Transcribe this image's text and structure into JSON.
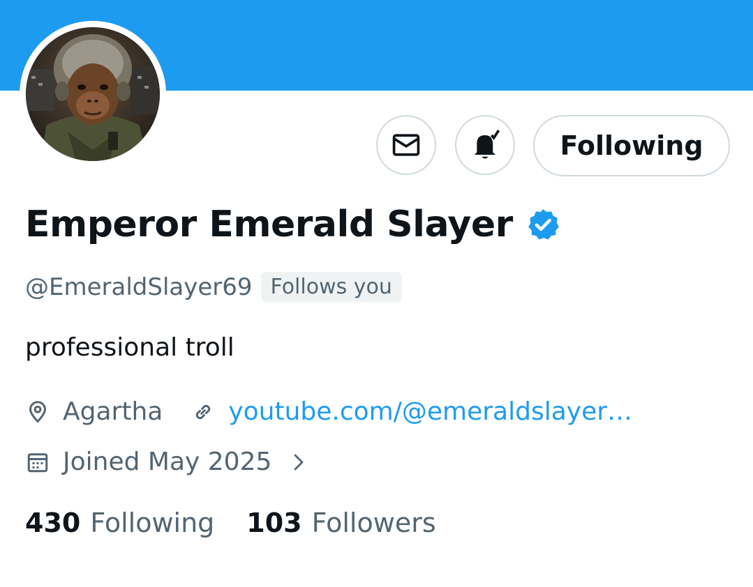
{
  "header": {
    "banner_color": "#1d9bf0"
  },
  "avatar": {
    "alt": "profile picture of a chimpanzee pilot in a flight helmet"
  },
  "actions": {
    "message_icon": "envelope-icon",
    "notifications_icon": "bell-check-icon",
    "follow_label": "Following"
  },
  "profile": {
    "display_name": "Emperor Emerald Slayer",
    "verified_icon": "verified-badge-icon",
    "handle": "@EmeraldSlayer69",
    "follows_you": "Follows you",
    "bio": "professional troll",
    "location": "Agartha",
    "website": "youtube.com/@emeraldslayer…",
    "joined": "Joined May 2025"
  },
  "stats": {
    "following_count": "430",
    "following_label": "Following",
    "followers_count": "103",
    "followers_label": "Followers"
  },
  "colors": {
    "accent": "#1d9bf0",
    "text": "#0f1419",
    "secondary": "#536471"
  }
}
